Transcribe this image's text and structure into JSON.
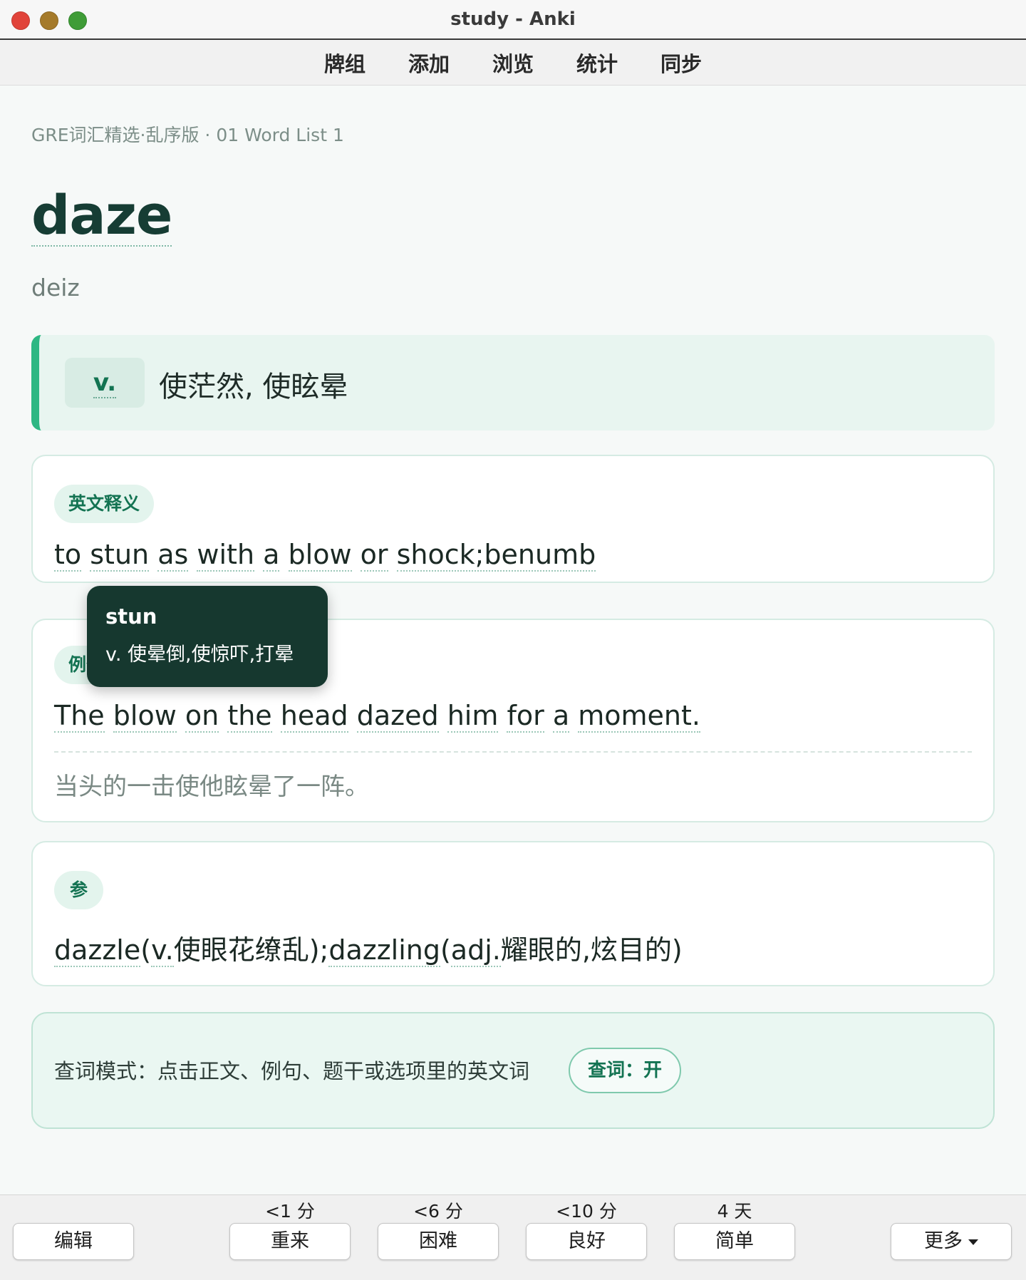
{
  "window": {
    "title": "study - Anki"
  },
  "toolbar": {
    "items": [
      "牌组",
      "添加",
      "浏览",
      "统计",
      "同步"
    ]
  },
  "card": {
    "breadcrumb": "GRE词汇精选·乱序版 · 01 Word List 1",
    "word": "daze",
    "phonetic": "deiz",
    "definition": {
      "pos": "v.",
      "text": "使茫然, 使眩晕"
    },
    "english": {
      "label": "英文释义",
      "words": [
        "to",
        "stun",
        "as",
        "with",
        "a",
        "blow",
        "or",
        "shock;benumb"
      ]
    },
    "example": {
      "label": "例句",
      "words": [
        "The",
        "blow",
        "on",
        "the",
        "head",
        "dazed",
        "him",
        "for",
        "a",
        "moment."
      ],
      "translation": "当头的一击使他眩晕了一阵。"
    },
    "related": {
      "label": "参",
      "segments": [
        "dazzle",
        "(",
        "v.",
        "使眼花缭乱);",
        "dazzling",
        "(",
        "adj.",
        "耀眼的,炫目的)"
      ]
    },
    "lookup": {
      "text": "查词模式：点击正文、例句、题干或选项里的英文词",
      "button": "查词：开"
    },
    "tooltip": {
      "word": "stun",
      "def": "v. 使晕倒,使惊吓,打晕"
    }
  },
  "answer_bar": {
    "edit": "编辑",
    "buttons": [
      {
        "interval": "<1 分",
        "label": "重来"
      },
      {
        "interval": "<6 分",
        "label": "困难"
      },
      {
        "interval": "<10 分",
        "label": "良好"
      },
      {
        "interval": "4 天",
        "label": "简单"
      }
    ],
    "more": "更多"
  }
}
